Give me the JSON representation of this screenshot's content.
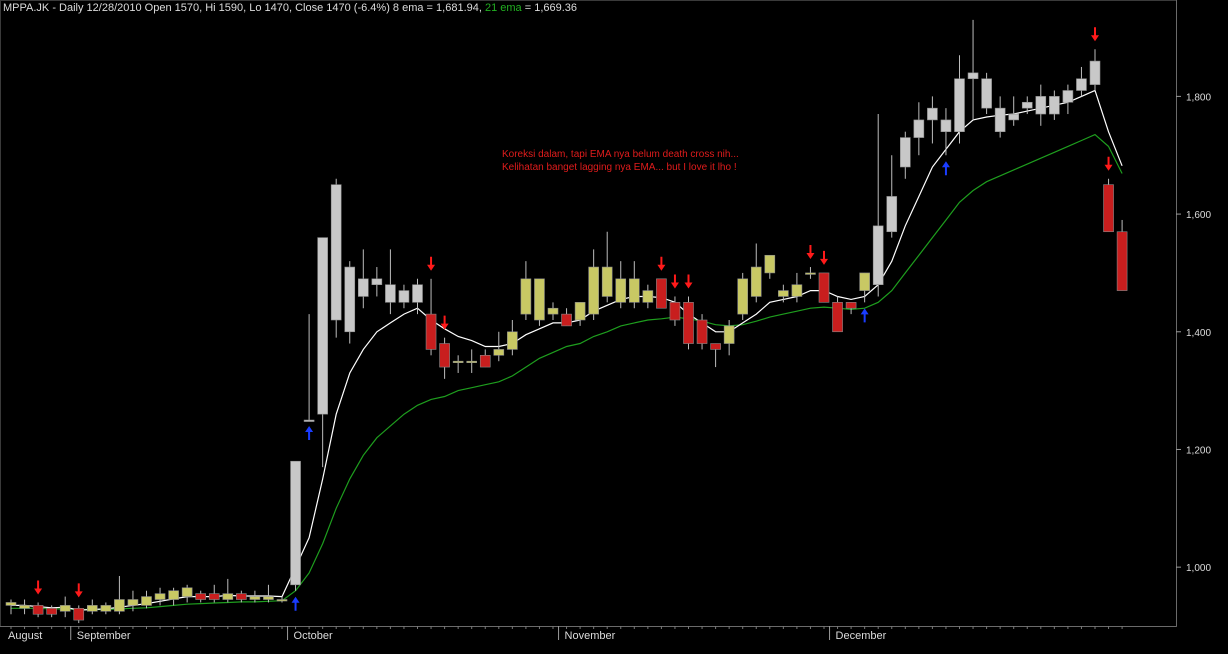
{
  "header": {
    "symbol": "MPPA.JK",
    "info": " - Daily 12/28/2010 Open 1570, Hi 1590, Lo 1470, Close 1470 (-6.4%) 8 ema = 1,681.94, ",
    "ema21_label": "21 ema",
    "ema21_value": " = 1,669.36"
  },
  "annotation": {
    "line1": "Koreksi dalam, tapi EMA nya belum death cross nih...",
    "line2": "Kelihatan banget lagging nya EMA... but I love it lho !"
  },
  "colors": {
    "background": "#000000",
    "up_candle": "#c8c8c8",
    "up_candle_yellow": "#c8c864",
    "down_candle": "#c81e1e",
    "ema8": "#ffffff",
    "ema21": "#1e9e1e",
    "sell_arrow": "#ff1a1a",
    "buy_arrow": "#1a3cff",
    "axis_text": "#dcdcdc"
  },
  "chart_data": {
    "type": "candlestick",
    "ylim": [
      900,
      1940
    ],
    "y_ticks": [
      "1,000",
      "1,200",
      "1,400",
      "1,600",
      "1,800"
    ],
    "y_tick_values": [
      1000,
      1200,
      1400,
      1600,
      1800
    ],
    "month_labels": [
      "August",
      "September",
      "October",
      "November",
      "December"
    ],
    "month_start_index": [
      0,
      5,
      21,
      41,
      61
    ],
    "candles": [
      {
        "o": 935,
        "h": 945,
        "l": 920,
        "c": 940,
        "col": "y"
      },
      {
        "o": 935,
        "h": 945,
        "l": 920,
        "c": 930,
        "col": "y"
      },
      {
        "o": 935,
        "h": 940,
        "l": 915,
        "c": 920,
        "col": "r"
      },
      {
        "o": 930,
        "h": 935,
        "l": 915,
        "c": 920,
        "col": "r"
      },
      {
        "o": 925,
        "h": 950,
        "l": 915,
        "c": 935,
        "col": "y"
      },
      {
        "o": 930,
        "h": 935,
        "l": 905,
        "c": 910,
        "col": "r"
      },
      {
        "o": 925,
        "h": 945,
        "l": 920,
        "c": 935,
        "col": "y"
      },
      {
        "o": 925,
        "h": 940,
        "l": 920,
        "c": 935,
        "col": "y"
      },
      {
        "o": 925,
        "h": 985,
        "l": 920,
        "c": 945,
        "col": "y"
      },
      {
        "o": 935,
        "h": 960,
        "l": 925,
        "c": 945,
        "col": "y"
      },
      {
        "o": 935,
        "h": 960,
        "l": 930,
        "c": 950,
        "col": "y"
      },
      {
        "o": 945,
        "h": 965,
        "l": 935,
        "c": 955,
        "col": "y"
      },
      {
        "o": 945,
        "h": 965,
        "l": 935,
        "c": 960,
        "col": "y"
      },
      {
        "o": 950,
        "h": 970,
        "l": 940,
        "c": 965,
        "col": "y"
      },
      {
        "o": 955,
        "h": 960,
        "l": 940,
        "c": 945,
        "col": "r"
      },
      {
        "o": 955,
        "h": 970,
        "l": 940,
        "c": 945,
        "col": "r"
      },
      {
        "o": 945,
        "h": 980,
        "l": 940,
        "c": 955,
        "col": "y"
      },
      {
        "o": 955,
        "h": 960,
        "l": 940,
        "c": 945,
        "col": "r"
      },
      {
        "o": 945,
        "h": 960,
        "l": 940,
        "c": 950,
        "col": "y"
      },
      {
        "o": 945,
        "h": 970,
        "l": 940,
        "c": 950,
        "col": "y"
      },
      {
        "o": 945,
        "h": 950,
        "l": 940,
        "c": 945,
        "col": "y"
      },
      {
        "o": 970,
        "h": 1180,
        "l": 960,
        "c": 1180,
        "col": "g"
      },
      {
        "o": 1250,
        "h": 1250,
        "l": 1250,
        "c": 1250,
        "col": "g",
        "h2": 1430,
        "l2": 1250
      },
      {
        "o": 1260,
        "h": 1560,
        "l": 1170,
        "c": 1560,
        "col": "g"
      },
      {
        "o": 1420,
        "h": 1660,
        "l": 1390,
        "c": 1650,
        "col": "g"
      },
      {
        "o": 1400,
        "h": 1520,
        "l": 1380,
        "c": 1510,
        "col": "g"
      },
      {
        "o": 1460,
        "h": 1540,
        "l": 1440,
        "c": 1490,
        "col": "g"
      },
      {
        "o": 1480,
        "h": 1510,
        "l": 1460,
        "c": 1490,
        "col": "g"
      },
      {
        "o": 1450,
        "h": 1540,
        "l": 1430,
        "c": 1480,
        "col": "g"
      },
      {
        "o": 1450,
        "h": 1480,
        "l": 1440,
        "c": 1470,
        "col": "g"
      },
      {
        "o": 1450,
        "h": 1490,
        "l": 1430,
        "c": 1480,
        "col": "g"
      },
      {
        "o": 1430,
        "h": 1490,
        "l": 1360,
        "c": 1370,
        "col": "r"
      },
      {
        "o": 1380,
        "h": 1390,
        "l": 1320,
        "c": 1340,
        "col": "r"
      },
      {
        "o": 1350,
        "h": 1360,
        "l": 1330,
        "c": 1350,
        "col": "y"
      },
      {
        "o": 1350,
        "h": 1370,
        "l": 1330,
        "c": 1350,
        "col": "y"
      },
      {
        "o": 1360,
        "h": 1370,
        "l": 1340,
        "c": 1340,
        "col": "r"
      },
      {
        "o": 1360,
        "h": 1400,
        "l": 1350,
        "c": 1370,
        "col": "y"
      },
      {
        "o": 1370,
        "h": 1420,
        "l": 1360,
        "c": 1400,
        "col": "y"
      },
      {
        "o": 1430,
        "h": 1520,
        "l": 1420,
        "c": 1490,
        "col": "y"
      },
      {
        "o": 1420,
        "h": 1490,
        "l": 1410,
        "c": 1490,
        "col": "y"
      },
      {
        "o": 1430,
        "h": 1450,
        "l": 1420,
        "c": 1440,
        "col": "y"
      },
      {
        "o": 1430,
        "h": 1440,
        "l": 1410,
        "c": 1410,
        "col": "r"
      },
      {
        "o": 1420,
        "h": 1450,
        "l": 1410,
        "c": 1450,
        "col": "y"
      },
      {
        "o": 1430,
        "h": 1540,
        "l": 1420,
        "c": 1510,
        "col": "y"
      },
      {
        "o": 1460,
        "h": 1570,
        "l": 1450,
        "c": 1510,
        "col": "y"
      },
      {
        "o": 1450,
        "h": 1520,
        "l": 1440,
        "c": 1490,
        "col": "y"
      },
      {
        "o": 1450,
        "h": 1520,
        "l": 1440,
        "c": 1490,
        "col": "y"
      },
      {
        "o": 1450,
        "h": 1480,
        "l": 1440,
        "c": 1470,
        "col": "y"
      },
      {
        "o": 1490,
        "h": 1490,
        "l": 1440,
        "c": 1440,
        "col": "r"
      },
      {
        "o": 1450,
        "h": 1460,
        "l": 1410,
        "c": 1420,
        "col": "r"
      },
      {
        "o": 1450,
        "h": 1460,
        "l": 1370,
        "c": 1380,
        "col": "r"
      },
      {
        "o": 1420,
        "h": 1430,
        "l": 1370,
        "c": 1380,
        "col": "r"
      },
      {
        "o": 1380,
        "h": 1380,
        "l": 1340,
        "c": 1370,
        "col": "r"
      },
      {
        "o": 1380,
        "h": 1420,
        "l": 1360,
        "c": 1410,
        "col": "y"
      },
      {
        "o": 1430,
        "h": 1500,
        "l": 1420,
        "c": 1490,
        "col": "y"
      },
      {
        "o": 1460,
        "h": 1550,
        "l": 1450,
        "c": 1510,
        "col": "y"
      },
      {
        "o": 1500,
        "h": 1530,
        "l": 1490,
        "c": 1530,
        "col": "y"
      },
      {
        "o": 1460,
        "h": 1480,
        "l": 1450,
        "c": 1470,
        "col": "y"
      },
      {
        "o": 1460,
        "h": 1500,
        "l": 1450,
        "c": 1480,
        "col": "y"
      },
      {
        "o": 1500,
        "h": 1510,
        "l": 1490,
        "c": 1500,
        "col": "y"
      },
      {
        "o": 1500,
        "h": 1500,
        "l": 1450,
        "c": 1450,
        "col": "r"
      },
      {
        "o": 1450,
        "h": 1460,
        "l": 1400,
        "c": 1400,
        "col": "r"
      },
      {
        "o": 1440,
        "h": 1450,
        "l": 1430,
        "c": 1450,
        "col": "r"
      },
      {
        "o": 1470,
        "h": 1500,
        "l": 1450,
        "c": 1500,
        "col": "y"
      },
      {
        "o": 1480,
        "h": 1770,
        "l": 1460,
        "c": 1580,
        "col": "g"
      },
      {
        "o": 1570,
        "h": 1700,
        "l": 1560,
        "c": 1630,
        "col": "g"
      },
      {
        "o": 1680,
        "h": 1740,
        "l": 1660,
        "c": 1730,
        "col": "g"
      },
      {
        "o": 1730,
        "h": 1790,
        "l": 1700,
        "c": 1760,
        "col": "g"
      },
      {
        "o": 1760,
        "h": 1800,
        "l": 1720,
        "c": 1780,
        "col": "g"
      },
      {
        "o": 1740,
        "h": 1780,
        "l": 1700,
        "c": 1760,
        "col": "g"
      },
      {
        "o": 1740,
        "h": 1870,
        "l": 1720,
        "c": 1830,
        "col": "g"
      },
      {
        "o": 1830,
        "h": 1930,
        "l": 1760,
        "c": 1840,
        "col": "g"
      },
      {
        "o": 1780,
        "h": 1840,
        "l": 1770,
        "c": 1830,
        "col": "g"
      },
      {
        "o": 1740,
        "h": 1800,
        "l": 1730,
        "c": 1780,
        "col": "g"
      },
      {
        "o": 1760,
        "h": 1800,
        "l": 1750,
        "c": 1770,
        "col": "g"
      },
      {
        "o": 1780,
        "h": 1800,
        "l": 1770,
        "c": 1790,
        "col": "g"
      },
      {
        "o": 1770,
        "h": 1820,
        "l": 1750,
        "c": 1800,
        "col": "g"
      },
      {
        "o": 1770,
        "h": 1810,
        "l": 1760,
        "c": 1800,
        "col": "g"
      },
      {
        "o": 1790,
        "h": 1820,
        "l": 1770,
        "c": 1810,
        "col": "g"
      },
      {
        "o": 1810,
        "h": 1850,
        "l": 1800,
        "c": 1830,
        "col": "g"
      },
      {
        "o": 1820,
        "h": 1880,
        "l": 1810,
        "c": 1860,
        "col": "g"
      },
      {
        "o": 1650,
        "h": 1660,
        "l": 1570,
        "c": 1570,
        "col": "r"
      },
      {
        "o": 1570,
        "h": 1590,
        "l": 1470,
        "c": 1470,
        "col": "r"
      }
    ],
    "ema8": [
      935,
      935,
      933,
      931,
      932,
      927,
      928,
      929,
      932,
      935,
      938,
      942,
      946,
      950,
      950,
      950,
      952,
      951,
      951,
      951,
      950,
      1000,
      1050,
      1150,
      1260,
      1330,
      1370,
      1400,
      1415,
      1430,
      1440,
      1420,
      1405,
      1392,
      1385,
      1375,
      1375,
      1380,
      1395,
      1405,
      1415,
      1415,
      1420,
      1435,
      1445,
      1455,
      1460,
      1460,
      1458,
      1450,
      1430,
      1415,
      1400,
      1400,
      1415,
      1430,
      1450,
      1455,
      1460,
      1470,
      1470,
      1460,
      1455,
      1460,
      1480,
      1520,
      1580,
      1630,
      1680,
      1710,
      1740,
      1760,
      1765,
      1768,
      1770,
      1775,
      1780,
      1785,
      1790,
      1800,
      1810,
      1740,
      1682
    ],
    "ema21": [
      930,
      930,
      930,
      929,
      929,
      928,
      928,
      928,
      929,
      930,
      931,
      933,
      935,
      937,
      938,
      939,
      940,
      941,
      941,
      942,
      943,
      960,
      990,
      1040,
      1100,
      1150,
      1190,
      1220,
      1240,
      1260,
      1275,
      1285,
      1290,
      1300,
      1305,
      1310,
      1315,
      1325,
      1340,
      1355,
      1365,
      1375,
      1380,
      1392,
      1400,
      1410,
      1415,
      1420,
      1422,
      1425,
      1422,
      1418,
      1412,
      1410,
      1412,
      1418,
      1425,
      1430,
      1435,
      1440,
      1442,
      1440,
      1438,
      1440,
      1450,
      1470,
      1500,
      1530,
      1560,
      1590,
      1620,
      1640,
      1655,
      1665,
      1675,
      1685,
      1695,
      1705,
      1715,
      1725,
      1735,
      1715,
      1669
    ],
    "sell_arrows": [
      2,
      5,
      31,
      32,
      48,
      49,
      50,
      59,
      60,
      80,
      81
    ],
    "buy_arrows": [
      21,
      22,
      63,
      69
    ]
  }
}
